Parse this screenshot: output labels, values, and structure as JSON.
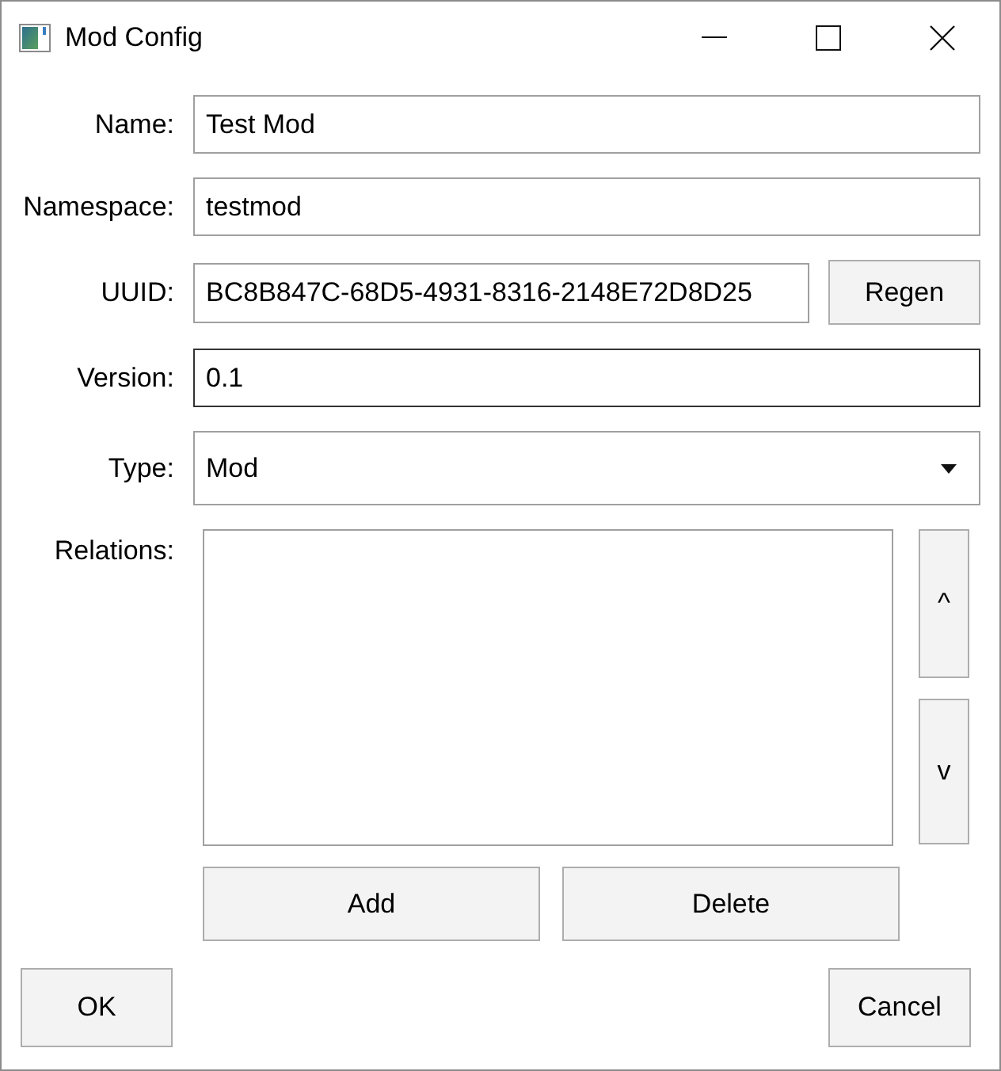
{
  "window": {
    "title": "Mod Config"
  },
  "fields": [
    {
      "kind": "text",
      "label": "Name:",
      "value": "Test Mod",
      "focused": false
    },
    {
      "kind": "text",
      "label": "Namespace:",
      "value": "testmod",
      "focused": false
    },
    {
      "kind": "text_button",
      "label": "UUID:",
      "value": "BC8B847C-68D5-4931-8316-2148E72D8D25",
      "button": "Regen",
      "focused": false
    },
    {
      "kind": "text",
      "label": "Version:",
      "value": "0.1",
      "focused": true
    },
    {
      "kind": "dropdown",
      "label": "Type:",
      "value": "Mod",
      "focused": false
    }
  ],
  "relations": {
    "label": "Relations:",
    "move_buttons": [
      "^",
      "v"
    ],
    "actions": [
      "Add",
      "Delete"
    ]
  },
  "footer_buttons": [
    "OK",
    "Cancel"
  ]
}
